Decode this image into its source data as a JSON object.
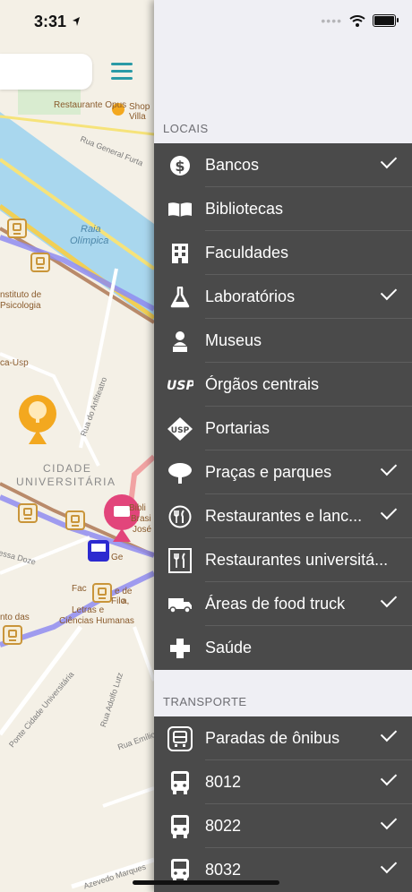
{
  "status_bar": {
    "time": "3:31"
  },
  "map": {
    "labels": {
      "opus": "Restaurante Opus",
      "villa_1": "Shop",
      "villa_2": "Villa",
      "rua_furtado": "Rua General Furta",
      "raia": "Raia",
      "olimpica": "Olímpica",
      "inst_1": "nstituto de",
      "inst_2": "Psicologia",
      "usp": "ca-Usp",
      "anfiteatro": "Rua do Anfiteatro",
      "cidade": "CIDADE",
      "universitaria": "UNIVERSITÁRIA",
      "biblio_1": "Bibli",
      "biblio_2": "Brasi",
      "biblio_3": "José",
      "doze": "essa Doze",
      "geo": "Ge",
      "fac_1": "Fac",
      "fac_2": "e de",
      "fac_3": "Filo",
      "fac_4": "a,",
      "letras": "Letras e",
      "ciencias": "Ciências Humanas",
      "nto_das": "nto das",
      "ponte": "Ponte Cidade Universitária",
      "adolfo": "Rua Adolfo Lutz",
      "emilio": "Rua Emílio",
      "azevedo": "Azevedo Marques"
    }
  },
  "drawer": {
    "sections": [
      {
        "header": "LOCAIS",
        "items": [
          {
            "label": "Bancos",
            "icon": "dollar-icon",
            "checked": true
          },
          {
            "label": "Bibliotecas",
            "icon": "book-icon",
            "checked": false
          },
          {
            "label": "Faculdades",
            "icon": "building-icon",
            "checked": false
          },
          {
            "label": "Laboratórios",
            "icon": "flask-icon",
            "checked": true
          },
          {
            "label": "Museus",
            "icon": "bust-icon",
            "checked": false
          },
          {
            "label": "Órgãos centrais",
            "icon": "usp-logo-icon",
            "checked": false
          },
          {
            "label": "Portarias",
            "icon": "usp-gate-icon",
            "checked": false
          },
          {
            "label": "Praças e parques",
            "icon": "tree-icon",
            "checked": true
          },
          {
            "label": "Restaurantes e lanc...",
            "icon": "cutlery-circle-icon",
            "checked": true
          },
          {
            "label": "Restaurantes universitá...",
            "icon": "cutlery-square-icon",
            "checked": false
          },
          {
            "label": "Áreas de food truck",
            "icon": "truck-icon",
            "checked": true
          },
          {
            "label": "Saúde",
            "icon": "cross-icon",
            "checked": false
          }
        ]
      },
      {
        "header": "TRANSPORTE",
        "items": [
          {
            "label": "Paradas de ônibus",
            "icon": "bus-stop-icon",
            "checked": true
          },
          {
            "label": "8012",
            "icon": "bus-icon",
            "checked": true
          },
          {
            "label": "8022",
            "icon": "bus-icon",
            "checked": true
          },
          {
            "label": "8032",
            "icon": "bus-icon",
            "checked": true
          }
        ]
      }
    ]
  }
}
